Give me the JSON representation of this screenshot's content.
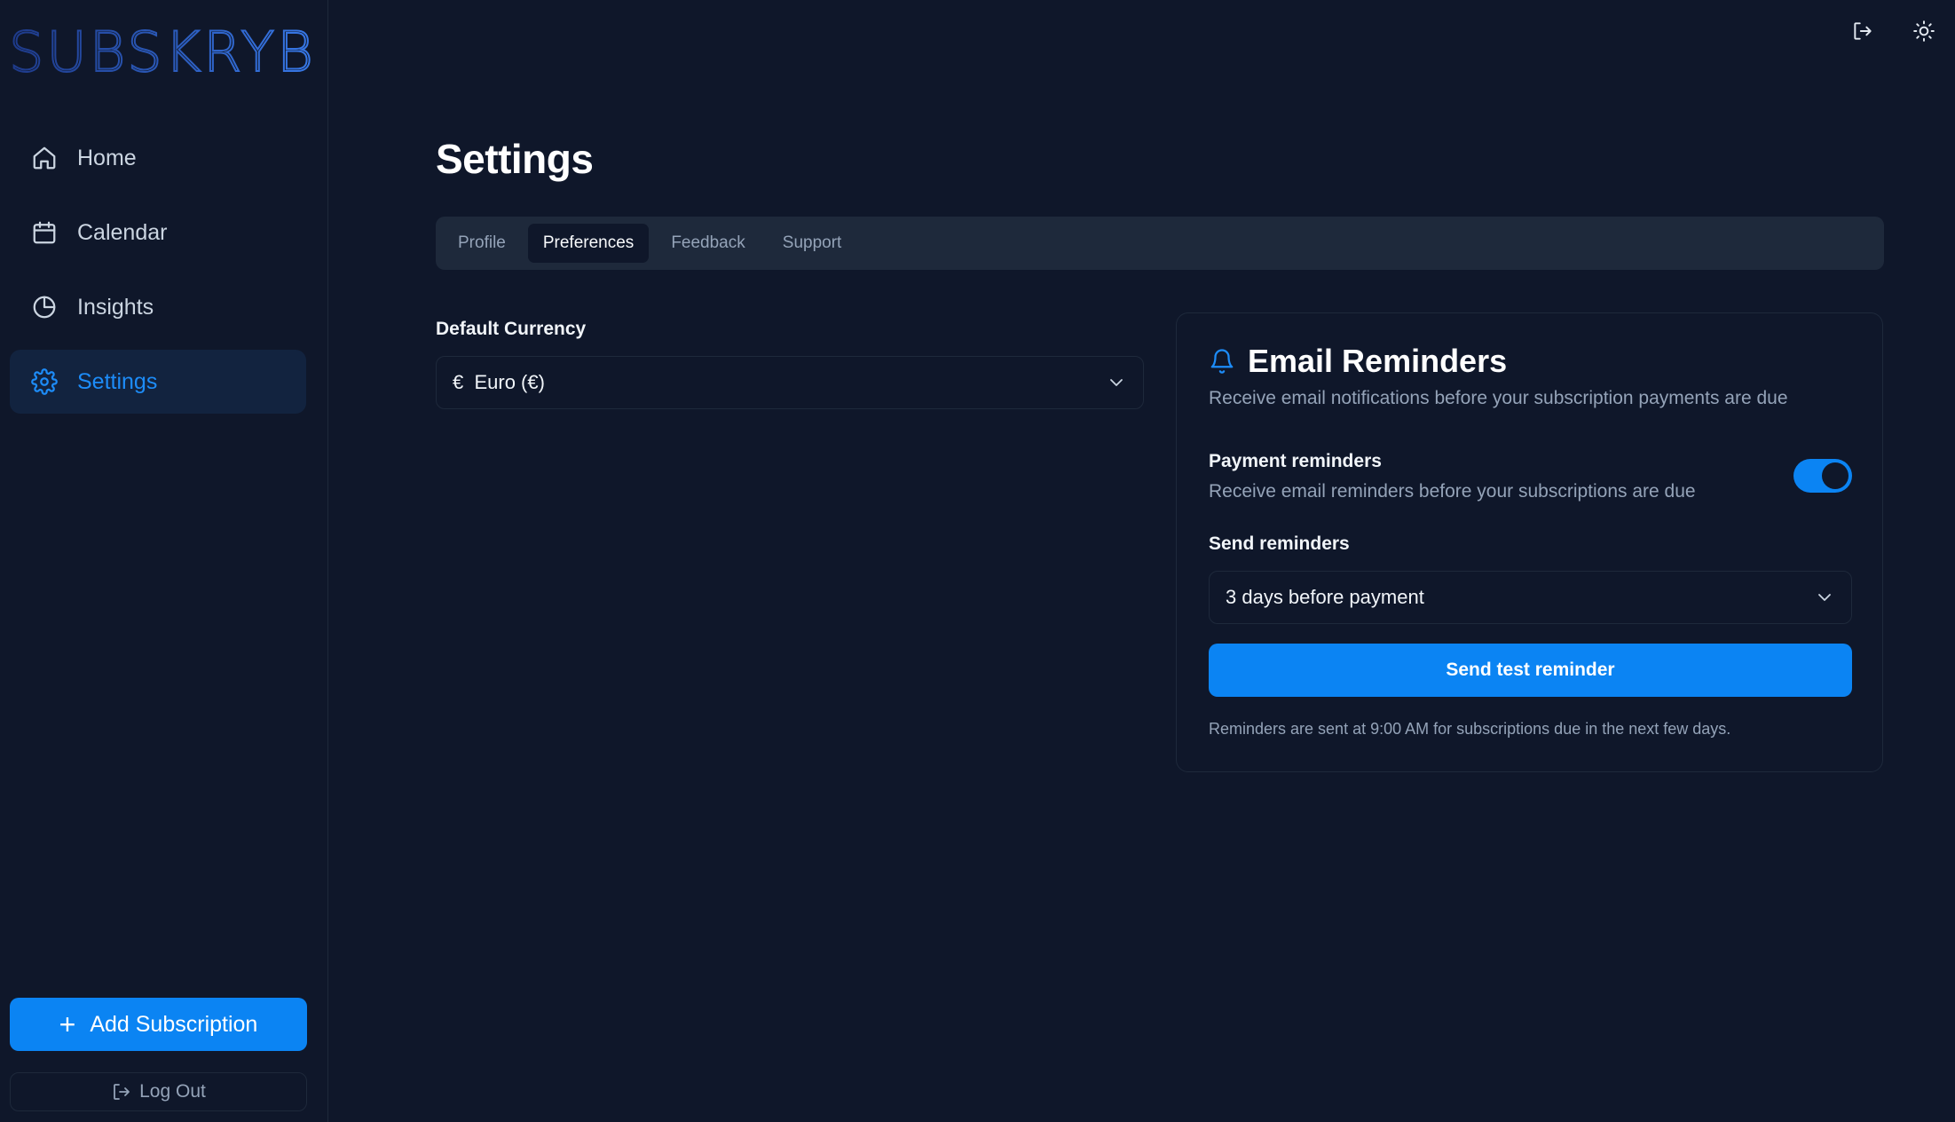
{
  "app": {
    "brand": "SUBSKRYBD"
  },
  "sidebar": {
    "items": [
      {
        "label": "Home",
        "icon": "home-icon"
      },
      {
        "label": "Calendar",
        "icon": "calendar-icon"
      },
      {
        "label": "Insights",
        "icon": "pie-chart-icon"
      },
      {
        "label": "Settings",
        "icon": "gear-icon",
        "active": true
      }
    ],
    "add_label": "Add Subscription",
    "logout_label": "Log Out"
  },
  "header": {
    "icons": [
      "logout-icon",
      "sun-icon"
    ]
  },
  "main": {
    "title": "Settings",
    "tabs": [
      {
        "label": "Profile"
      },
      {
        "label": "Preferences",
        "active": true
      },
      {
        "label": "Feedback"
      },
      {
        "label": "Support"
      }
    ],
    "currency": {
      "label": "Default Currency",
      "symbol": "€",
      "value": "€  Euro (€)"
    },
    "reminders": {
      "title": "Email Reminders",
      "subtitle": "Receive email notifications before your subscription payments are due",
      "payment_label": "Payment reminders",
      "payment_desc": "Receive email reminders before your subscriptions are due",
      "payment_enabled": true,
      "send_label": "Send reminders",
      "send_value": "3 days before payment",
      "test_button": "Send test reminder",
      "footnote": "Reminders are sent at 9:00 AM for subscriptions due in the next few days."
    }
  },
  "colors": {
    "background": "#0f172a",
    "accent": "#0b84f3",
    "active_nav_bg": "#12233f",
    "muted_text": "#94a3b8"
  }
}
